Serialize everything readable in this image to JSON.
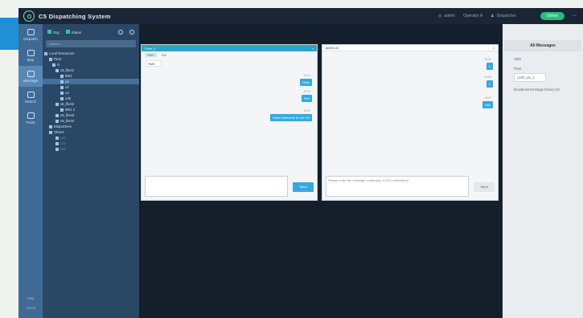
{
  "app": {
    "title": "C5 Dispatching System"
  },
  "topbar": {
    "user1": "admin",
    "user2": "Operator A",
    "user3": "Dispatcher",
    "status": "Online",
    "menu": "—"
  },
  "rail": {
    "items": [
      {
        "label": "Dispatch",
        "active": false
      },
      {
        "label": "Map",
        "active": false
      },
      {
        "label": "Message",
        "active": true
      },
      {
        "label": "Search",
        "active": false
      },
      {
        "label": "Trunk",
        "active": false
      }
    ],
    "bottom": [
      "Help",
      "About"
    ]
  },
  "tree": {
    "toolbar": {
      "btn1": "Org",
      "btn2": "Status"
    },
    "search_placeholder": "Search...",
    "nodes": [
      {
        "label": "Local Resources",
        "indent": 2,
        "sel": false,
        "dim": false
      },
      {
        "label": "Fleet",
        "indent": 8,
        "sel": false,
        "dim": false
      },
      {
        "label": "G",
        "indent": 12,
        "sel": false,
        "dim": false
      },
      {
        "label": "u5_fleet1",
        "indent": 16,
        "sel": false,
        "dim": false
      },
      {
        "label": "IB01",
        "indent": 22,
        "sel": false,
        "dim": false
      },
      {
        "label": "u4",
        "indent": 22,
        "sel": true,
        "dim": false
      },
      {
        "label": "u2",
        "indent": 22,
        "sel": false,
        "dim": false
      },
      {
        "label": "u3",
        "indent": 22,
        "sel": false,
        "dim": false
      },
      {
        "label": "u4b",
        "indent": 22,
        "sel": false,
        "dim": false
      },
      {
        "label": "u5_fleet2",
        "indent": 16,
        "sel": false,
        "dim": false
      },
      {
        "label": "IB01 2",
        "indent": 22,
        "sel": false,
        "dim": false
      },
      {
        "label": "u5_fleet3",
        "indent": 16,
        "sel": false,
        "dim": false
      },
      {
        "label": "u5_fleet4",
        "indent": 16,
        "sel": false,
        "dim": false
      },
      {
        "label": "Dispatchers",
        "indent": 8,
        "sel": false,
        "dim": false
      },
      {
        "label": "Others",
        "indent": 8,
        "sel": false,
        "dim": false
      },
      {
        "label": "u41",
        "indent": 16,
        "sel": false,
        "dim": true
      },
      {
        "label": "u42",
        "indent": 16,
        "sel": false,
        "dim": true
      },
      {
        "label": "u43",
        "indent": 16,
        "sel": false,
        "dim": true
      }
    ]
  },
  "panel1": {
    "title": "Fleet_4",
    "close": "×",
    "tabs": [
      "SMS",
      "File"
    ],
    "incoming": "SMS",
    "messages": [
      {
        "text": "Hello",
        "time": "10:01"
      },
      {
        "text": "Test",
        "time": "10:02"
      },
      {
        "text": "Hello! Welcome to use C5",
        "time": "10:03"
      }
    ],
    "send": "Send"
  },
  "panel2": {
    "title": "Ip400-01",
    "close": "×",
    "messages": [
      {
        "text": "1",
        "time": "10:05"
      },
      {
        "text": "2",
        "time": "10:06"
      },
      {
        "text": "Test",
        "time": "10:07"
      }
    ],
    "input_placeholder": "Please enter the message content(up to 512 characters)",
    "send": "Send"
  },
  "right": {
    "title": "All Messages",
    "items": [
      "SMS",
      "Fleet",
      "u100_ws_1",
      "Broadcast message history list"
    ]
  }
}
